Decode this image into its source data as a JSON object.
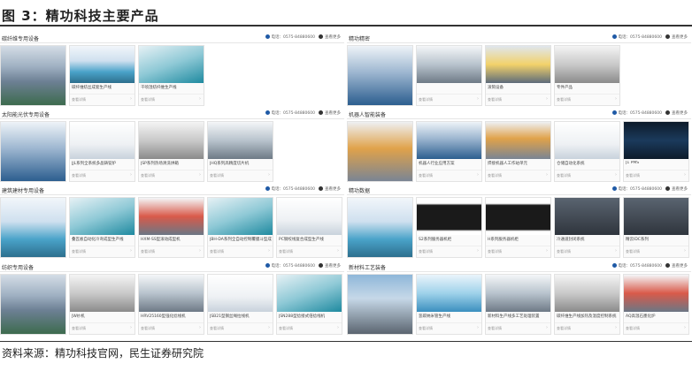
{
  "figure": {
    "title": "图 3：精功科技主要产品",
    "source": "资料来源：精功科技官网，民生证券研究院"
  },
  "labels": {
    "phone": "电话：0575-84880600",
    "more": "查看更多",
    "detail": "查看详情",
    "arrow": "›"
  },
  "left": [
    {
      "title": "碳纤维专用设备",
      "items": [
        "",
        "碳纤维纺丝成套生产线",
        "干喷湿纺纤维生产线"
      ]
    },
    {
      "title": "太阳能光伏专用设备",
      "items": [
        "",
        "JJL系列全系统多晶铸锭炉",
        "JSP系列热场清洗烘箱",
        "JHQ系列高精度切片机"
      ]
    },
    {
      "title": "建筑建材专用设备",
      "items": [
        "",
        "叠瓦板自动化冷弯成型生产线",
        "HXM-SS型滚动成型机",
        "JBH-DA系列全自动控制覆膜斗型成型机",
        "PC钢绞线复合成型生产线"
      ]
    },
    {
      "title": "纺织专用设备",
      "items": [
        "",
        "JW纱机",
        "HRV25160型强化捻线机",
        "JSB21型钢丝绳拉线机",
        "JSN288型捻接式倍捻线机"
      ]
    }
  ],
  "right": [
    {
      "title": "精功精密",
      "items": [
        "",
        "",
        "滚筒设备",
        "专件产品"
      ]
    },
    {
      "title": "机器人智能装备",
      "items": [
        "",
        "机器人行业应用方案",
        "焊接机器人工作站单元",
        "仓储自动化系统",
        "J1 PMS"
      ]
    },
    {
      "title": "精功数据",
      "items": [
        "",
        "S2系列服务器机柜",
        "H系列服务器机柜",
        "冷通道封闭系统",
        "精云IDC系列"
      ]
    },
    {
      "title": "新材料工艺装备",
      "items": [
        "",
        "氢碳纳米管生产线",
        "新材料生产线多工艺处理装置",
        "碳纤维生产线加热及温度控制系统",
        "AQ高温石墨化炉"
      ]
    }
  ]
}
